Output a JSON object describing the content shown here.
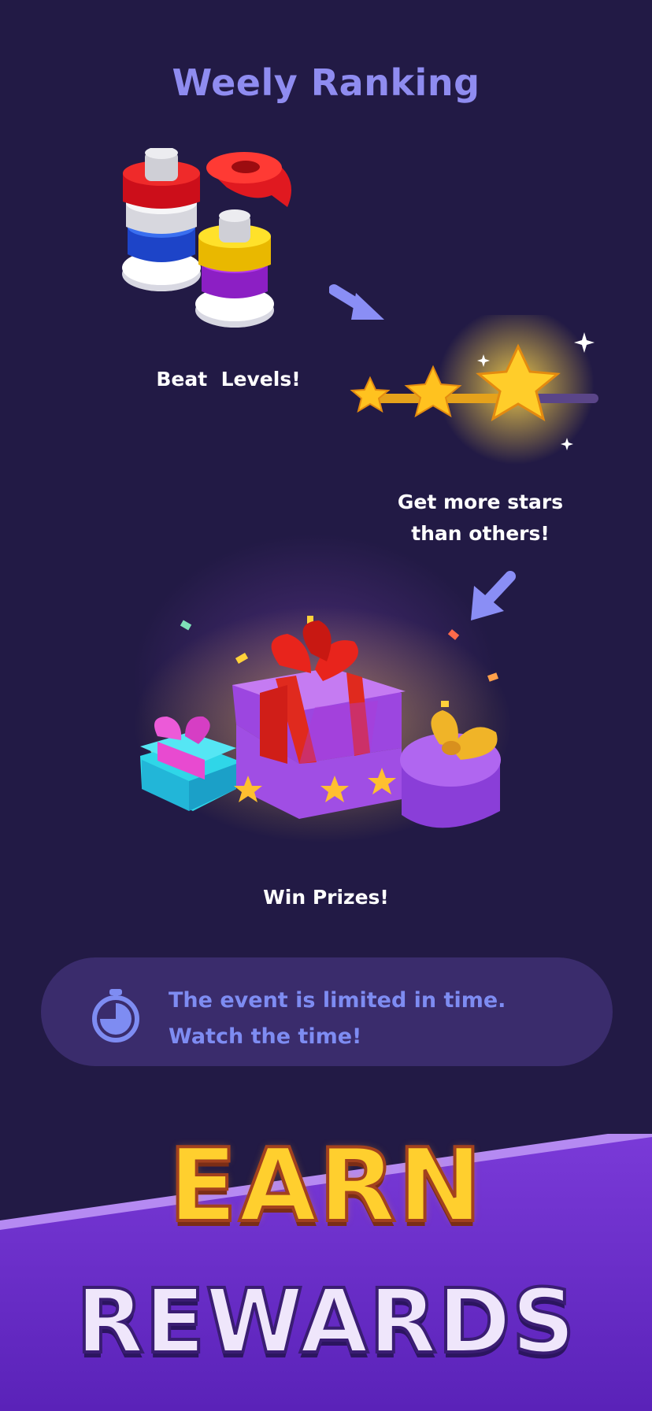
{
  "header": {
    "title": "Weely Ranking"
  },
  "steps": [
    {
      "caption": "Beat  Levels!",
      "icon": "nuts-bolts-icon"
    },
    {
      "caption_line1": "Get more stars",
      "caption_line2": "than others!",
      "icon": "star-progress-icon"
    },
    {
      "caption": "Win Prizes!",
      "icon": "gift-boxes-icon"
    }
  ],
  "notice": {
    "line1": "The event is limited in time.",
    "line2": "Watch the time!",
    "icon": "stopwatch-icon"
  },
  "banner": {
    "line1": "EARN",
    "line2": "REWARDS"
  },
  "colors": {
    "background": "#221a45",
    "title": "#8f8cf0",
    "panel": "#3a2c6c",
    "notice_text": "#7e8cf2",
    "ribbon": "#6a33c8",
    "earn": "#ffcf2e",
    "rewards": "#efe6fb"
  }
}
